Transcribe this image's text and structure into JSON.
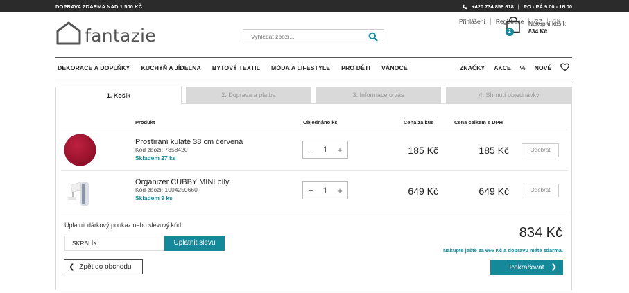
{
  "topbar": {
    "shipping": "DOPRAVA ZDARMA NAD 1 500 KČ",
    "phone": "+420 734 858 618",
    "hours": "PO - PÁ 9.00 - 16.00"
  },
  "logo": {
    "word": "fantazie"
  },
  "search": {
    "placeholder": "Vyhledat zboží..."
  },
  "account": {
    "login": "Přihlášení",
    "register": "Registrace",
    "lang_cz": "CZ",
    "lang_sk": "SK"
  },
  "cart": {
    "label": "Nákupní košík",
    "total": "834 Kč",
    "count": "2"
  },
  "nav": {
    "items": [
      "DEKORACE A DOPLŇKY",
      "KUCHYŇ A JÍDELNA",
      "BYTOVÝ TEXTIL",
      "MÓDA A LIFESTYLE",
      "PRO DĚTI",
      "VÁNOCE"
    ],
    "right": [
      "ZNAČKY",
      "AKCE",
      "%",
      "NOVÉ"
    ]
  },
  "steps": [
    "1. Košík",
    "2. Doprava a platba",
    "3. Informace o vás",
    "4. Shrnutí objednávky"
  ],
  "table": {
    "headers": {
      "product": "Produkt",
      "ordered": "Objednáno ks",
      "unit_price": "Cena za kus",
      "total_price": "Cena celkem s DPH"
    },
    "rows": [
      {
        "name": "Prostírání kulaté 38 cm červená",
        "code": "Kód zboží: 7858420",
        "stock": "Skladem 27 ks",
        "qty": "1",
        "unit": "185 Kč",
        "total": "185 Kč",
        "remove": "Odebrat"
      },
      {
        "name": "Organizér CUBBY MINI bílý",
        "code": "Kód zboží: 1004250660",
        "stock": "Skladem 9 ks",
        "qty": "1",
        "unit": "649 Kč",
        "total": "649 Kč",
        "remove": "Odebrat"
      }
    ]
  },
  "voucher": {
    "label": "Uplatnit dárkový poukaz nebo slevový kód",
    "value": "SKRBLÍK",
    "button": "Uplatnit slevu"
  },
  "summary": {
    "total": "834 Kč",
    "free_shipping_note": "Nakupte ještě za 666 Kč a dopravu máte zdarma."
  },
  "actions": {
    "back": "Zpět do obchodu",
    "continue": "Pokračovat"
  },
  "colors": {
    "accent": "#15899a",
    "topbar": "#2b2b2b",
    "red_product": "#a3142c"
  }
}
